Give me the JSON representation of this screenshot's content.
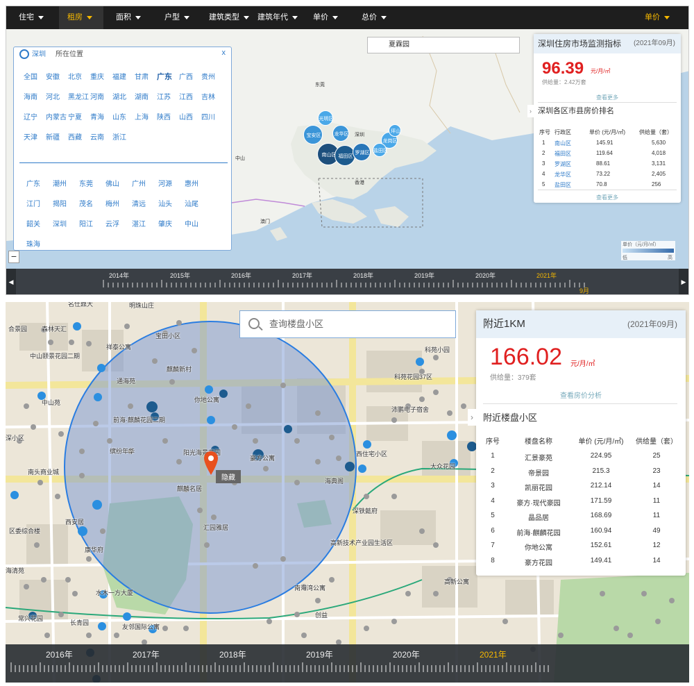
{
  "filterbar": {
    "items": [
      {
        "label": "住宅",
        "active": false,
        "yellow": true
      },
      {
        "label": "租房",
        "active": true,
        "yellow": false
      },
      {
        "label": "面积",
        "active": false,
        "yellow": false
      },
      {
        "label": "户型",
        "active": false,
        "yellow": false
      },
      {
        "label": "建筑类型",
        "active": false,
        "yellow": false
      },
      {
        "label": "建筑年代",
        "active": false,
        "yellow": false
      },
      {
        "label": "单价",
        "active": false,
        "yellow": false
      },
      {
        "label": "总价",
        "active": false,
        "yellow": false
      }
    ],
    "right_label": "单价"
  },
  "map1": {
    "search_value": "夏霖园",
    "city_panel": {
      "city": "深圳",
      "location_label": "所在位置",
      "close_label": "x",
      "provinces": [
        [
          "全国",
          "安徽",
          "北京",
          "重庆",
          "福建",
          "甘肃",
          "广东",
          "广西",
          "贵州"
        ],
        [
          "海南",
          "河北",
          "黑龙江",
          "河南",
          "湖北",
          "湖南",
          "江苏",
          "江西",
          "吉林"
        ],
        [
          "辽宁",
          "内蒙古",
          "宁夏",
          "青海",
          "山东",
          "上海",
          "陕西",
          "山西",
          "四川"
        ],
        [
          "天津",
          "新疆",
          "西藏",
          "云南",
          "浙江"
        ]
      ],
      "cities": [
        [
          "广东",
          "潮州",
          "东莞",
          "佛山",
          "广州",
          "河源",
          "惠州"
        ],
        [
          "江门",
          "揭阳",
          "茂名",
          "梅州",
          "清远",
          "汕头",
          "汕尾"
        ],
        [
          "韶关",
          "深圳",
          "阳江",
          "云浮",
          "湛江",
          "肇庆",
          "中山"
        ],
        [
          "珠海"
        ]
      ]
    },
    "district_bubbles": [
      {
        "name": "光明区",
        "color": "#4aa8e8"
      },
      {
        "name": "宝安区",
        "color": "#3b95d8"
      },
      {
        "name": "龙华区",
        "color": "#3b95d8"
      },
      {
        "name": "龙岗区",
        "color": "#4aa8e8"
      },
      {
        "name": "南山区",
        "color": "#1d4f7c"
      },
      {
        "name": "福田区",
        "color": "#1d5b8e"
      },
      {
        "name": "罗湖区",
        "color": "#2876b8"
      },
      {
        "name": "盐田区",
        "color": "#4aa8e8"
      },
      {
        "name": "坪山",
        "color": "#4aa8e8"
      }
    ],
    "place_labels": [
      "东莞",
      "深圳",
      "中山",
      "香港",
      "澳门"
    ],
    "legend": {
      "title": "单价（元/月/㎡）",
      "low": "低",
      "high": "高"
    }
  },
  "stats1": {
    "title": "深圳住房市场监测指标",
    "date": "(2021年09月)",
    "price": "96.39",
    "unit": "元/月/㎡",
    "supply": "供给量：2.42万套",
    "more_link": "查看更多",
    "ranking_title": "深圳各区市县房价排名",
    "columns": [
      "序号",
      "行政区",
      "单价 (元/月/㎡)",
      "供给量（套）"
    ],
    "rows": [
      [
        "1",
        "南山区",
        "145.91",
        "5,630"
      ],
      [
        "2",
        "福田区",
        "119.64",
        "4,018"
      ],
      [
        "3",
        "罗湖区",
        "88.61",
        "3,131"
      ],
      [
        "4",
        "龙华区",
        "73.22",
        "2,405"
      ],
      [
        "5",
        "盐田区",
        "70.8",
        "256"
      ]
    ],
    "more_link2": "查看更多"
  },
  "timeline1": {
    "years": [
      "2014年",
      "2015年",
      "2016年",
      "2017年",
      "2018年",
      "2019年",
      "2020年",
      "2021年"
    ],
    "current_year": "2021年",
    "current_month": "9月",
    "prev_icon": "chevron-left-icon",
    "next_icon": "chevron-right-icon"
  },
  "map2": {
    "search_placeholder": "查询楼盘小区",
    "marker_label": "隐藏",
    "place_labels": [
      "名仕鼎大",
      "明珠山庄",
      "合景园",
      "森林天汇",
      "宝田小区",
      "祥泰公寓",
      "中山颐景花园二期",
      "科苑小园",
      "麒麟新村",
      "通海苑",
      "科苑花园37区",
      "中山苑",
      "你地公寓",
      "沛鹏电子宿舍",
      "前海·麒麟花园二期",
      "深小区",
      "缤纷年华",
      "阳光海景花园",
      "豪方公寓",
      "西住宅小区",
      "大众花园",
      "南头商业城",
      "麒麟名居",
      "海典阁",
      "深铁懿府",
      "西安居",
      "汇园雅居",
      "区委综合楼",
      "高新技术产业园生活区",
      "康华府",
      "海清苑",
      "水木一方大厦",
      "南海湾公寓",
      "高新公寓",
      "常兴花园",
      "长青园",
      "友邻国际公寓",
      "创益"
    ]
  },
  "stats2": {
    "title": "附近1KM",
    "date": "(2021年09月)",
    "price": "166.02",
    "unit": "元/月/㎡",
    "supply": "供给量：379套",
    "more_link": "查看房价分析",
    "list_title": "附近楼盘小区",
    "columns": [
      "序号",
      "楼盘名称",
      "单价 (元/月/㎡)",
      "供给量（套）"
    ],
    "rows": [
      [
        "1",
        "汇景豪苑",
        "224.95",
        "25"
      ],
      [
        "2",
        "帝景园",
        "215.3",
        "23"
      ],
      [
        "3",
        "凯丽花园",
        "212.14",
        "14"
      ],
      [
        "4",
        "豪方·现代豪园",
        "171.59",
        "11"
      ],
      [
        "5",
        "晶品居",
        "168.69",
        "11"
      ],
      [
        "6",
        "前海·麒麟花园",
        "160.94",
        "49"
      ],
      [
        "7",
        "你地公寓",
        "152.61",
        "12"
      ],
      [
        "8",
        "豪方花园",
        "149.41",
        "14"
      ]
    ]
  },
  "timeline2": {
    "years": [
      "2016年",
      "2017年",
      "2018年",
      "2019年",
      "2020年",
      "2021年"
    ],
    "current_year": "2021年"
  },
  "colors": {
    "accent": "#f6b800",
    "price_red": "#e02020",
    "link_blue": "#2f7bc9",
    "circle_blue": "#2a7de1"
  }
}
